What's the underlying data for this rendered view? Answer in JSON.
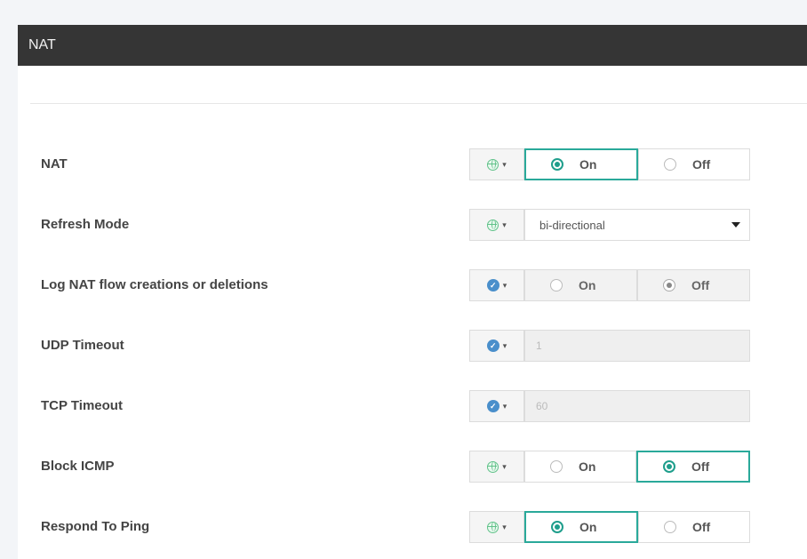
{
  "header": {
    "title": "NAT"
  },
  "colors": {
    "accent": "#2aa99a",
    "header_bg": "#353535",
    "globe": "#62c28a",
    "check": "#4a8fcb"
  },
  "rows": [
    {
      "label": "NAT",
      "scope_icon": "globe-icon",
      "type": "toggle",
      "on_label": "On",
      "off_label": "Off",
      "selected": "On",
      "disabled": false
    },
    {
      "label": "Refresh Mode",
      "scope_icon": "globe-icon",
      "type": "select",
      "value": "bi-directional"
    },
    {
      "label": "Log NAT flow creations or deletions",
      "scope_icon": "check-icon",
      "type": "toggle",
      "on_label": "On",
      "off_label": "Off",
      "selected": "Off",
      "disabled": true
    },
    {
      "label": "UDP Timeout",
      "scope_icon": "check-icon",
      "type": "input",
      "value": "1"
    },
    {
      "label": "TCP Timeout",
      "scope_icon": "check-icon",
      "type": "input",
      "value": "60"
    },
    {
      "label": "Block ICMP",
      "scope_icon": "globe-icon",
      "type": "toggle",
      "on_label": "On",
      "off_label": "Off",
      "selected": "Off",
      "disabled": false
    },
    {
      "label": "Respond To Ping",
      "scope_icon": "globe-icon",
      "type": "toggle",
      "on_label": "On",
      "off_label": "Off",
      "selected": "On",
      "disabled": false
    }
  ]
}
